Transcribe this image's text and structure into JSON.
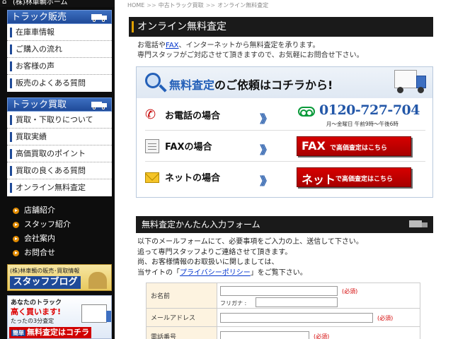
{
  "sidebar": {
    "home_link": "(株)林車輌ホーム",
    "sales": {
      "heading": "トラック販売",
      "items": [
        "在庫車情報",
        "ご購入の流れ",
        "お客様の声",
        "販売のよくある質問"
      ]
    },
    "purchase": {
      "heading": "トラック買取",
      "items": [
        "買取・下取りについて",
        "買取実績",
        "高価買取のポイント",
        "買取の良くある質問",
        "オンライン無料査定"
      ]
    },
    "info_links": [
      "店舗紹介",
      "スタッフ紹介",
      "会社案内",
      "お問合せ"
    ],
    "blog_banner": {
      "line1": "(株)林車輌の販売･買取情報",
      "line2": "スタッフブログ"
    },
    "buy_banner": {
      "line1": "あなたのトラック",
      "line2": "高く買います!",
      "line3": "たったの3分査定",
      "badge": "簡単",
      "line4": "無料査定はコチラ"
    }
  },
  "breadcrumb": [
    "HOME",
    "中古トラック買取",
    "オンライン無料査定"
  ],
  "page_title": "オンライン無料査定",
  "intro": {
    "line1_a": "お電話や",
    "line1_link": "FAX",
    "line1_b": "、インターネットから無料査定を承ります。",
    "line2": "専門スタッフがご対応させて頂きますので、お気軽にお問合せ下さい。"
  },
  "contact": {
    "heading_hl": "無料査定",
    "heading_rest": "のご依頼はコチラから!",
    "phone_label": "お電話の場合",
    "phone_number": "0120-727-704",
    "phone_hours": "月〜金曜日 午前9時〜午後6時",
    "fax_label": "FAXの場合",
    "fax_btn_big": "FAX",
    "fax_btn_small": "で高価査定はこちら",
    "net_label": "ネットの場合",
    "net_btn_big": "ネット",
    "net_btn_small": "で高価査定はこちら",
    "chevrons": "》》"
  },
  "form": {
    "bar_title": "無料査定かんたん入力フォーム",
    "intro_lines": [
      "以下のメールフォームにて、必要事項をご入力の上、送信して下さい。",
      "追って専門スタッフよりご連絡させて頂きます。",
      "尚、お客様情報のお取扱いに関しましては、"
    ],
    "policy_a": "当サイトの「",
    "policy_link": "プライバシーポリシー",
    "policy_b": "」をご覧下さい。",
    "fields": {
      "name_label": "お名前",
      "furigana_label": "フリガナ :",
      "email_label": "メールアドレス",
      "phone_label": "電話番号"
    },
    "required": "(必須)"
  }
}
